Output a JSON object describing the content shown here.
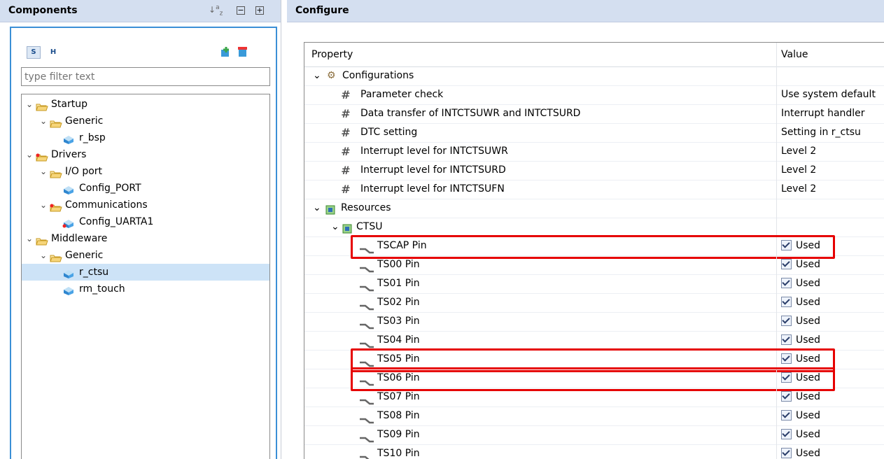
{
  "components": {
    "title": "Components",
    "filter_placeholder": "type filter text",
    "tree": [
      {
        "label": "Startup",
        "level": 0,
        "kind": "folder",
        "expanded": true
      },
      {
        "label": "Generic",
        "level": 1,
        "kind": "folder",
        "expanded": true
      },
      {
        "label": "r_bsp",
        "level": 2,
        "kind": "component"
      },
      {
        "label": "Drivers",
        "level": 0,
        "kind": "folder-red",
        "expanded": true
      },
      {
        "label": "I/O port",
        "level": 1,
        "kind": "folder",
        "expanded": true
      },
      {
        "label": "Config_PORT",
        "level": 2,
        "kind": "component"
      },
      {
        "label": "Communications",
        "level": 1,
        "kind": "folder-red",
        "expanded": true
      },
      {
        "label": "Config_UARTA1",
        "level": 2,
        "kind": "component-red"
      },
      {
        "label": "Middleware",
        "level": 0,
        "kind": "folder",
        "expanded": true
      },
      {
        "label": "Generic",
        "level": 1,
        "kind": "folder",
        "expanded": true
      },
      {
        "label": "r_ctsu",
        "level": 2,
        "kind": "component",
        "selected": true
      },
      {
        "label": "rm_touch",
        "level": 2,
        "kind": "component"
      }
    ]
  },
  "configure": {
    "title": "Configure",
    "col_property": "Property",
    "col_value": "Value",
    "configurations_label": "Configurations",
    "settings": [
      {
        "name": "Parameter check",
        "value": "Use system default"
      },
      {
        "name": "Data transfer of INTCTSUWR and INTCTSURD",
        "value": "Interrupt handler"
      },
      {
        "name": "DTC setting",
        "value": "Setting in r_ctsu"
      },
      {
        "name": "Interrupt level for INTCTSUWR",
        "value": "Level 2"
      },
      {
        "name": "Interrupt level for INTCTSURD",
        "value": "Level 2"
      },
      {
        "name": "Interrupt level for INTCTSUFN",
        "value": "Level 2"
      }
    ],
    "resources_label": "Resources",
    "ctsu_label": "CTSU",
    "pins": [
      {
        "name": "TSCAP Pin",
        "value": "Used",
        "highlighted": true
      },
      {
        "name": "TS00 Pin",
        "value": "Used"
      },
      {
        "name": "TS01 Pin",
        "value": "Used"
      },
      {
        "name": "TS02 Pin",
        "value": "Used"
      },
      {
        "name": "TS03 Pin",
        "value": "Used"
      },
      {
        "name": "TS04 Pin",
        "value": "Used"
      },
      {
        "name": "TS05 Pin",
        "value": "Used",
        "highlighted": true
      },
      {
        "name": "TS06 Pin",
        "value": "Used",
        "highlighted": true
      },
      {
        "name": "TS07 Pin",
        "value": "Used"
      },
      {
        "name": "TS08 Pin",
        "value": "Used"
      },
      {
        "name": "TS09 Pin",
        "value": "Used"
      },
      {
        "name": "TS10 Pin",
        "value": "Used"
      }
    ]
  },
  "colors": {
    "highlight": "#e60000",
    "header_bg": "#d4dff0",
    "selection": "#cde3f7"
  }
}
